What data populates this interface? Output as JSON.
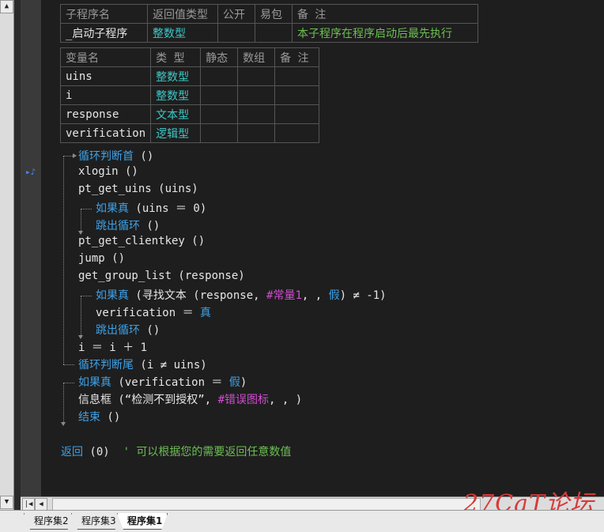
{
  "sub_table": {
    "headers": [
      "子程序名",
      "返回值类型",
      "公开",
      "易包",
      "备 注"
    ],
    "row": [
      "_启动子程序",
      "整数型",
      "",
      "",
      "本子程序在程序启动后最先执行"
    ]
  },
  "var_table": {
    "headers": [
      "变量名",
      "类 型",
      "静态",
      "数组",
      "备 注"
    ],
    "rows": [
      [
        "uins",
        "整数型",
        "",
        "",
        ""
      ],
      [
        "i",
        "整数型",
        "",
        "",
        ""
      ],
      [
        "response",
        "文本型",
        "",
        "",
        ""
      ],
      [
        "verification",
        "逻辑型",
        "",
        "",
        ""
      ]
    ]
  },
  "code": {
    "l1": "循环判断首",
    "l1b": " ()",
    "l2": "xlogin ()",
    "l3": "pt_get_uins (uins)",
    "l4": "如果真",
    "l4b": " (uins ＝ 0)",
    "l5": "跳出循环",
    "l5b": " ()",
    "l6": "pt_get_clientkey ()",
    "l7": "jump ()",
    "l8": "get_group_list (response)",
    "l9": "如果真",
    "l9b": " (寻找文本 (response, ",
    "l9c": "#常量1",
    "l9d": ", , ",
    "l9e": "假",
    "l9f": ") ≠ -1)",
    "l10": "verification ＝ ",
    "l10b": "真",
    "l11": "跳出循环",
    "l11b": " ()",
    "l12": "i ＝ i ＋ 1",
    "l13": "循环判断尾",
    "l13b": " (i ≠ uins)",
    "l14": "如果真",
    "l14b": " (verification ＝ ",
    "l14c": "假",
    "l14d": ")",
    "l15": "信息框 (“检测不到授权”, ",
    "l15b": "#错误图标",
    "l15c": ", , )",
    "l16": "结束",
    "l16b": " ()",
    "l17": "返回",
    "l17b": " (0)  ",
    "l17c": "' 可以根据您的需要返回任意数值"
  },
  "tabs": [
    "程序集2",
    "程序集3",
    "程序集1"
  ],
  "watermark": "27CaT论坛",
  "colors": {
    "keyword": "#3ea2e8",
    "type": "#3ec8c8",
    "comment": "#6dbf54",
    "constant": "#d24cd2",
    "background": "#1e1e1e"
  }
}
